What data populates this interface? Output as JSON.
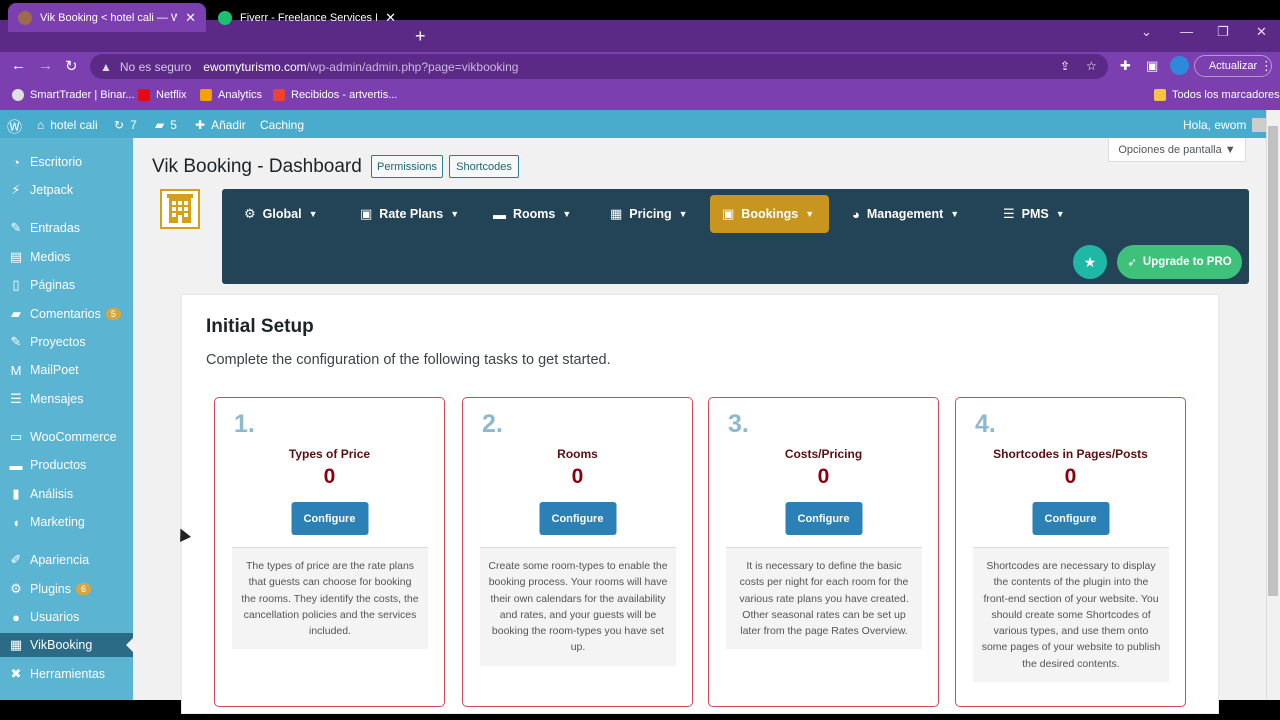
{
  "browser": {
    "tabs": [
      {
        "title": "Vik Booking < hotel cali — Word",
        "active": true,
        "favicon_color": "#9d6a4d"
      },
      {
        "title": "Fiverr - Freelance Services Marke",
        "active": false,
        "favicon_color": "#1dbf73"
      }
    ],
    "new_tab": "+",
    "url_warning": "No es seguro",
    "url_host": "ewomyturismo.com",
    "url_path": "/wp-admin/admin.php?page=vikbooking",
    "update_button": "Actualizar",
    "bookmarks": [
      {
        "label": "SmartTrader | Binar...",
        "color": "#e0e0e0"
      },
      {
        "label": "Netflix",
        "color": "#e50914"
      },
      {
        "label": "Analytics",
        "color": "#f4a100"
      },
      {
        "label": "Recibidos - artvertis...",
        "color": "#ea4335"
      }
    ],
    "all_bookmarks": "Todos los marcadores"
  },
  "adminbar": {
    "site": "hotel cali",
    "updates": "7",
    "comments": "5",
    "add": "Añadir",
    "caching": "Caching",
    "greeting": "Hola, ewom"
  },
  "sidebar": {
    "items": [
      {
        "label": "Escritorio",
        "icon": "dashboard-icon"
      },
      {
        "label": "Jetpack",
        "icon": "jetpack-icon"
      },
      {
        "label": "Entradas",
        "icon": "pin-icon"
      },
      {
        "label": "Medios",
        "icon": "media-icon"
      },
      {
        "label": "Páginas",
        "icon": "page-icon"
      },
      {
        "label": "Comentarios",
        "icon": "comment-icon",
        "badge": "5"
      },
      {
        "label": "Proyectos",
        "icon": "pin-icon"
      },
      {
        "label": "MailPoet",
        "icon": "mailpoet-icon"
      },
      {
        "label": "Mensajes",
        "icon": "messages-icon"
      },
      {
        "label": "WooCommerce",
        "icon": "woo-icon"
      },
      {
        "label": "Productos",
        "icon": "products-icon"
      },
      {
        "label": "Análisis",
        "icon": "chart-icon"
      },
      {
        "label": "Marketing",
        "icon": "megaphone-icon"
      },
      {
        "label": "Apariencia",
        "icon": "brush-icon"
      },
      {
        "label": "Plugins",
        "icon": "plugin-icon",
        "badge": "6"
      },
      {
        "label": "Usuarios",
        "icon": "user-icon"
      },
      {
        "label": "VikBooking",
        "icon": "hotel-icon",
        "current": true
      },
      {
        "label": "Herramientas",
        "icon": "wrench-icon"
      }
    ]
  },
  "header": {
    "title": "Vik Booking - Dashboard",
    "permissions": "Permissions",
    "shortcodes": "Shortcodes",
    "screen_options": "Opciones de pantalla ▼"
  },
  "nav": {
    "items": [
      {
        "label": "Global",
        "icon": "gears-icon"
      },
      {
        "label": "Rate Plans",
        "icon": "briefcase-icon"
      },
      {
        "label": "Rooms",
        "icon": "bed-icon"
      },
      {
        "label": "Pricing",
        "icon": "table-icon"
      },
      {
        "label": "Bookings",
        "icon": "calendar-check-icon",
        "active": true
      },
      {
        "label": "Management",
        "icon": "pie-chart-icon"
      },
      {
        "label": "PMS",
        "icon": "list-icon"
      }
    ],
    "upgrade": "Upgrade to PRO"
  },
  "setup": {
    "title": "Initial Setup",
    "subtitle": "Complete the configuration of the following tasks to get started.",
    "cards": [
      {
        "num": "1.",
        "title": "Types of Price",
        "count": "0",
        "button": "Configure",
        "desc": "The types of price are the rate plans that guests can choose for booking the rooms. They identify the costs, the cancellation policies and the services included."
      },
      {
        "num": "2.",
        "title": "Rooms",
        "count": "0",
        "button": "Configure",
        "desc": "Create some room-types to enable the booking process. Your rooms will have their own calendars for the availability and rates, and your guests will be booking the room-types you have set up."
      },
      {
        "num": "3.",
        "title": "Costs/Pricing",
        "count": "0",
        "button": "Configure",
        "desc": "It is necessary to define the basic costs per night for each room for the various rate plans you have created. Other seasonal rates can be set up later from the page Rates Overview."
      },
      {
        "num": "4.",
        "title": "Shortcodes in Pages/Posts",
        "count": "0",
        "button": "Configure",
        "desc": "Shortcodes are necessary to display the contents of the plugin into the front-end section of your website. You should create some Shortcodes of various types, and use them onto some pages of your website to publish the desired contents."
      }
    ]
  }
}
